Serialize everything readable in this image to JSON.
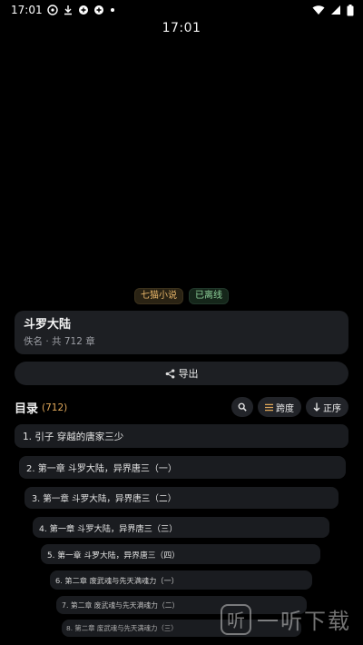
{
  "status_bar": {
    "time": "17:01"
  },
  "clock": "17:01",
  "tags": {
    "source": "七猫小说",
    "offline": "已离线"
  },
  "book": {
    "title": "斗罗大陆",
    "meta": "佚名 · 共 712 章"
  },
  "export_label": "导出",
  "toc": {
    "title": "目录",
    "count": "(712)",
    "progress_label": "跨度",
    "sort_label": "正序"
  },
  "chapters": [
    "1. 引子 穿越的唐家三少",
    "2. 第一章 斗罗大陆，异界唐三（一）",
    "3. 第一章 斗罗大陆，异界唐三（二）",
    "4. 第一章 斗罗大陆，异界唐三（三）",
    "5. 第一章 斗罗大陆，异界唐三（四）",
    "6. 第二章 废武魂与先天满魂力（一）",
    "7. 第二章 废武魂与先天满魂力（二）",
    "8. 第二章 废武魂与先天满魂力（三）"
  ],
  "watermark": {
    "logo": "听",
    "text": "一听下载"
  }
}
